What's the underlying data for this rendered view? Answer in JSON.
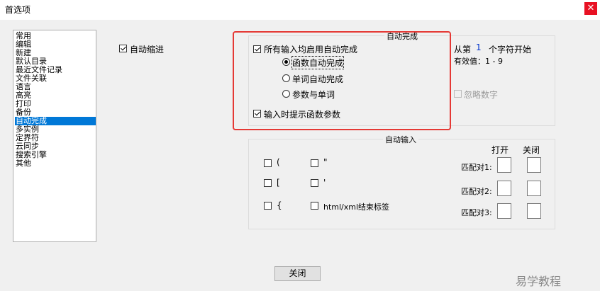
{
  "window": {
    "title": "首选项",
    "close_glyph": "✕"
  },
  "sidebar": {
    "items": [
      "常用",
      "编辑",
      "新建",
      "默认目录",
      "最近文件记录",
      "文件关联",
      "语言",
      "高亮",
      "打印",
      "备份",
      "自动完成",
      "多实例",
      "定界符",
      "云同步",
      "搜索引擎",
      "其他"
    ],
    "selected": "自动完成"
  },
  "auto_indent": {
    "label": "自动缩进",
    "checked": true
  },
  "autocomplete_group": {
    "title": "自动完成",
    "enable_all": {
      "label": "所有输入均启用自动完成",
      "checked": true
    },
    "options": [
      {
        "label": "函数自动完成",
        "checked": true
      },
      {
        "label": "单词自动完成",
        "checked": false
      },
      {
        "label": "参数与单词",
        "checked": false
      }
    ],
    "show_params": {
      "label": "输入时提示函数参数",
      "checked": true
    },
    "start_from_prefix": "从第",
    "start_from_value": "1",
    "start_from_suffix": "个字符开始",
    "valid_range": "有效值：1 - 9",
    "ignore_numbers": {
      "label": "忽略数字",
      "checked": false,
      "disabled": true
    }
  },
  "autoinput_group": {
    "title": "自动输入",
    "items": [
      {
        "label": "(",
        "checked": false
      },
      {
        "label": "\"",
        "checked": false
      },
      {
        "label": "[",
        "checked": false
      },
      {
        "label": "'",
        "checked": false
      },
      {
        "label": "{",
        "checked": false
      },
      {
        "label": "html/xml结束标签",
        "checked": false
      }
    ],
    "open_header": "打开",
    "close_header": "关闭",
    "pairs": [
      "匹配对1:",
      "匹配对2:",
      "匹配对3:"
    ]
  },
  "footer": {
    "close_button": "关闭"
  },
  "watermark": "易学教程",
  "colors": {
    "selection": "#0078d7",
    "highlight_box": "#e53935",
    "close_button_bg": "#e81123"
  }
}
